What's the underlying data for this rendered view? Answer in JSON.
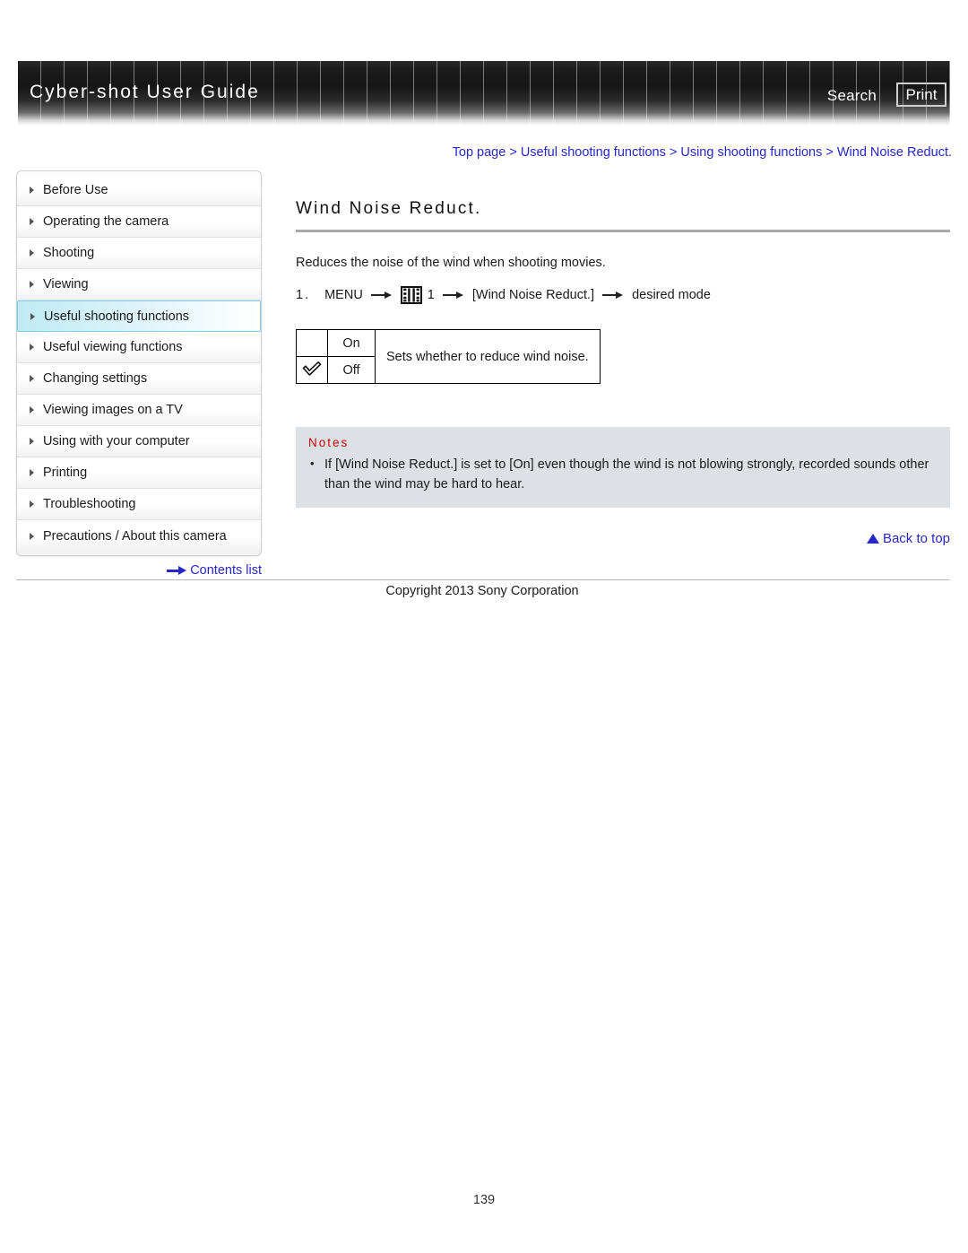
{
  "header": {
    "title": "Cyber-shot User Guide",
    "search_label": "Search",
    "print_label": "Print"
  },
  "breadcrumb": {
    "items": [
      "Top page",
      "Useful shooting functions",
      "Using shooting functions",
      "Wind Noise Reduct."
    ],
    "separator": " > ",
    "text": "Top page > Useful shooting functions > Using shooting functions > Wind Noise Reduct.",
    "color": "#2727c8"
  },
  "sidebar": {
    "items": [
      {
        "label": "Before Use",
        "active": false
      },
      {
        "label": "Operating the camera",
        "active": false
      },
      {
        "label": "Shooting",
        "active": false
      },
      {
        "label": "Viewing",
        "active": false
      },
      {
        "label": "Useful shooting functions",
        "active": true
      },
      {
        "label": "Useful viewing functions",
        "active": false
      },
      {
        "label": "Changing settings",
        "active": false
      },
      {
        "label": "Viewing images on a TV",
        "active": false
      },
      {
        "label": "Using with your computer",
        "active": false
      },
      {
        "label": "Printing",
        "active": false
      },
      {
        "label": "Troubleshooting",
        "active": false
      },
      {
        "label": "Precautions / About this camera",
        "active": false
      }
    ],
    "contents_list_label": "Contents list",
    "active_color": "#7fcfe4"
  },
  "main": {
    "title": "Wind Noise Reduct.",
    "intro": "Reduces the noise of the wind when shooting movies.",
    "step": {
      "number": "1.",
      "menu_label": "MENU",
      "icon_name": "movie-mode-icon",
      "tab_number": "1",
      "item_label": "[Wind Noise Reduct.]",
      "result_label": "desired mode"
    },
    "options_table": {
      "rows": [
        {
          "checked": "",
          "option": "On",
          "description": "Sets whether to reduce wind noise."
        },
        {
          "checked": "checkmark",
          "option": "Off",
          "description": ""
        }
      ],
      "description": "Sets whether to reduce wind noise."
    },
    "notes": {
      "title": "Notes",
      "title_color": "#d00000",
      "background": "#dde1e6",
      "items": [
        "If [Wind Noise Reduct.] is set to [On] even though the wind is not blowing strongly, recorded sounds other than the wind may be hard to hear."
      ]
    },
    "back_to_top_label": "Back to top"
  },
  "footer": {
    "copyright": "Copyright 2013 Sony Corporation",
    "page_number": "139"
  }
}
